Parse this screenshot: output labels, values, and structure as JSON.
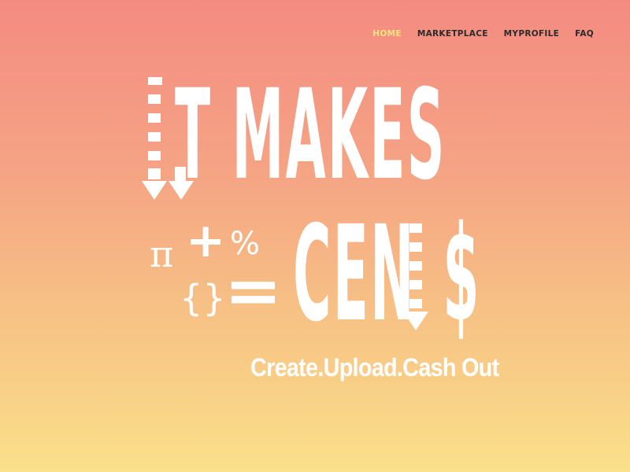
{
  "nav": {
    "items": [
      "HOME",
      "MARKETPLACE",
      "MYPROFILE",
      "FAQ"
    ],
    "active_color": "#fbe37d",
    "text_color": "#2b2b2b"
  },
  "hero": {
    "line1": "T MAKES",
    "line2": "CEN",
    "line2_end": "$",
    "sym_pi": "π",
    "sym_plus": "+",
    "sym_percent": "%",
    "sym_braces": "{}",
    "sym_equals": "=",
    "tagline": "Create.Upload.Cash Out"
  },
  "colors": {
    "gradient_top": "#f48b82",
    "gradient_bottom": "#fae08a",
    "text": "#ffffff"
  }
}
